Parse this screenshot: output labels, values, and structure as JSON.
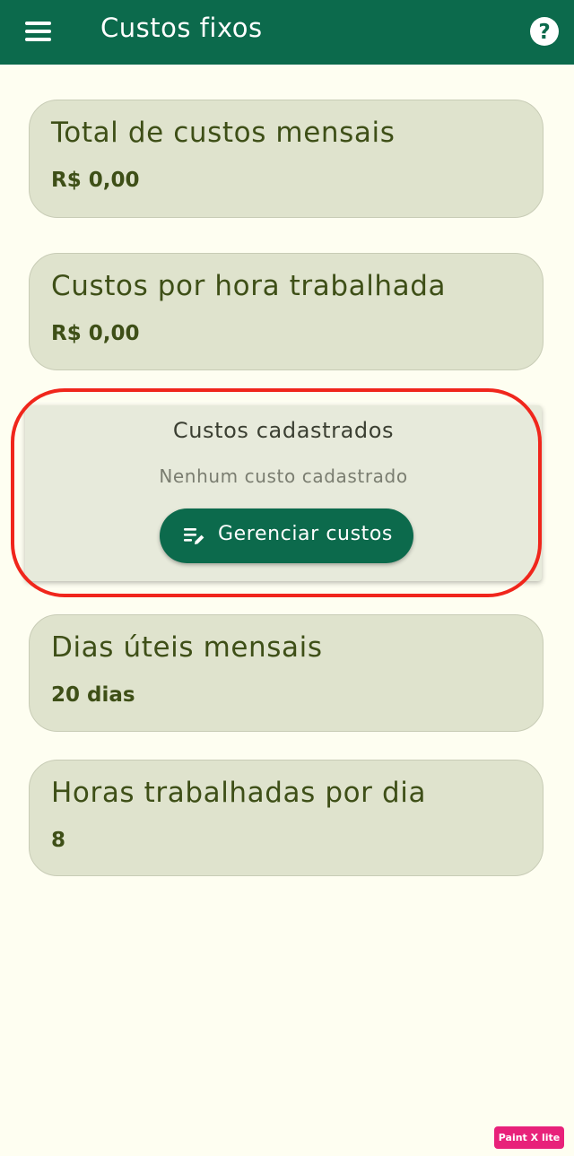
{
  "appbar": {
    "title": "Custos fixos",
    "menu_icon": "menu-icon",
    "help_icon": "help-icon",
    "background_color": "#0c6a4c"
  },
  "cards": {
    "monthly_total": {
      "title": "Total de custos mensais",
      "value": "R$ 0,00"
    },
    "hourly_cost": {
      "title": "Custos por hora trabalhada",
      "value": "R$ 0,00"
    },
    "registered_costs": {
      "title": "Custos cadastrados",
      "empty_text": "Nenhum custo cadastrado",
      "button_label": "Gerenciar custos",
      "button_icon": "edit-list-icon"
    },
    "working_days": {
      "title": "Dias úteis mensais",
      "value": "20 dias"
    },
    "hours_per_day": {
      "title": "Horas trabalhadas por dia",
      "value": "8"
    }
  },
  "annotation": {
    "highlight_color": "#f0261c"
  },
  "watermark": {
    "text": "Paint X lite"
  }
}
